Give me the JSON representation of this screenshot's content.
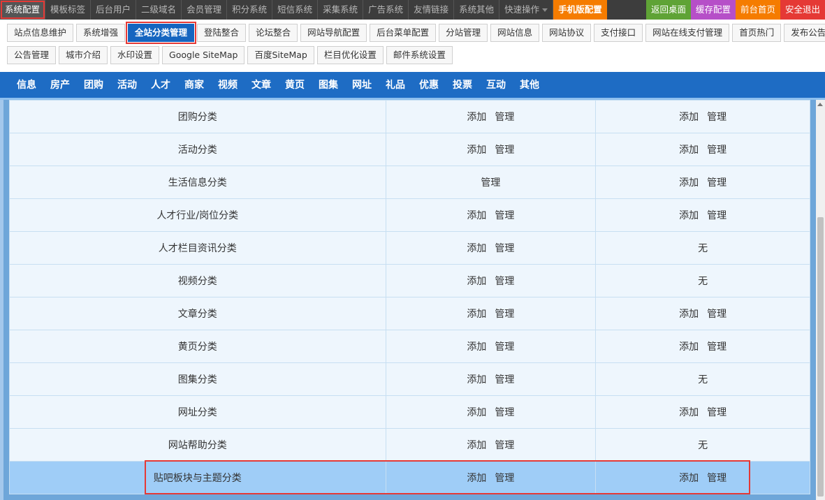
{
  "top_menu": [
    {
      "label": "系统配置"
    },
    {
      "label": "模板标签"
    },
    {
      "label": "后台用户"
    },
    {
      "label": "二级域名"
    },
    {
      "label": "会员管理"
    },
    {
      "label": "积分系统"
    },
    {
      "label": "短信系统"
    },
    {
      "label": "采集系统"
    },
    {
      "label": "广告系统"
    },
    {
      "label": "友情链接"
    },
    {
      "label": "系统其他"
    },
    {
      "label": "快速操作"
    },
    {
      "label": "手机版配置"
    }
  ],
  "top_right": [
    {
      "label": "返回桌面",
      "color": "#5fa336"
    },
    {
      "label": "缓存配置",
      "color": "#b64fc8"
    },
    {
      "label": "前台首页",
      "color": "#f57c00"
    },
    {
      "label": "安全退出",
      "color": "#e53935"
    }
  ],
  "sub_nav": {
    "row1": [
      "站点信息维护",
      "系统增强",
      "全站分类管理",
      "登陆整合",
      "论坛整合",
      "网站导航配置",
      "后台菜单配置",
      "分站管理",
      "网站信息",
      "网站协议",
      "支付接口",
      "网站在线支付管理",
      "首页热门",
      "发布公告"
    ],
    "row2": [
      "公告管理",
      "城市介绍",
      "水印设置",
      "Google SiteMap",
      "百度SiteMap",
      "栏目优化设置",
      "邮件系统设置"
    ]
  },
  "category_bar": [
    "信息",
    "房产",
    "团购",
    "活动",
    "人才",
    "商家",
    "视频",
    "文章",
    "黄页",
    "图集",
    "网址",
    "礼品",
    "优惠",
    "投票",
    "互动",
    "其他"
  ],
  "actions": {
    "add": "添加",
    "manage": "管理",
    "none": "无"
  },
  "rows": [
    {
      "name": "团购分类",
      "col2": [
        "添加",
        "管理"
      ],
      "col3": [
        "添加",
        "管理"
      ]
    },
    {
      "name": "活动分类",
      "col2": [
        "添加",
        "管理"
      ],
      "col3": [
        "添加",
        "管理"
      ]
    },
    {
      "name": "生活信息分类",
      "col2": [
        "管理"
      ],
      "col3": [
        "添加",
        "管理"
      ]
    },
    {
      "name": "人才行业/岗位分类",
      "col2": [
        "添加",
        "管理"
      ],
      "col3": [
        "添加",
        "管理"
      ]
    },
    {
      "name": "人才栏目资讯分类",
      "col2": [
        "添加",
        "管理"
      ],
      "col3": [
        "无"
      ]
    },
    {
      "name": "视频分类",
      "col2": [
        "添加",
        "管理"
      ],
      "col3": [
        "无"
      ]
    },
    {
      "name": "文章分类",
      "col2": [
        "添加",
        "管理"
      ],
      "col3": [
        "添加",
        "管理"
      ]
    },
    {
      "name": "黄页分类",
      "col2": [
        "添加",
        "管理"
      ],
      "col3": [
        "添加",
        "管理"
      ]
    },
    {
      "name": "图集分类",
      "col2": [
        "添加",
        "管理"
      ],
      "col3": [
        "无"
      ]
    },
    {
      "name": "网址分类",
      "col2": [
        "添加",
        "管理"
      ],
      "col3": [
        "添加",
        "管理"
      ]
    },
    {
      "name": "网站帮助分类",
      "col2": [
        "添加",
        "管理"
      ],
      "col3": [
        "无"
      ]
    },
    {
      "name": "贴吧板块与主题分类",
      "col2": [
        "添加",
        "管理"
      ],
      "col3": [
        "添加",
        "管理"
      ]
    }
  ],
  "state": {
    "active_top_menu": "系统配置",
    "active_sub_nav": "全站分类管理",
    "highlighted_row": "贴吧板块与主题分类"
  },
  "colors": {
    "topbar_bg": "#3d3d3d",
    "accent_blue": "#1e6cc4",
    "highlight_red": "#e53935",
    "row_bg": "#eef6fd",
    "row_highlight_bg": "#9fcdf7"
  }
}
